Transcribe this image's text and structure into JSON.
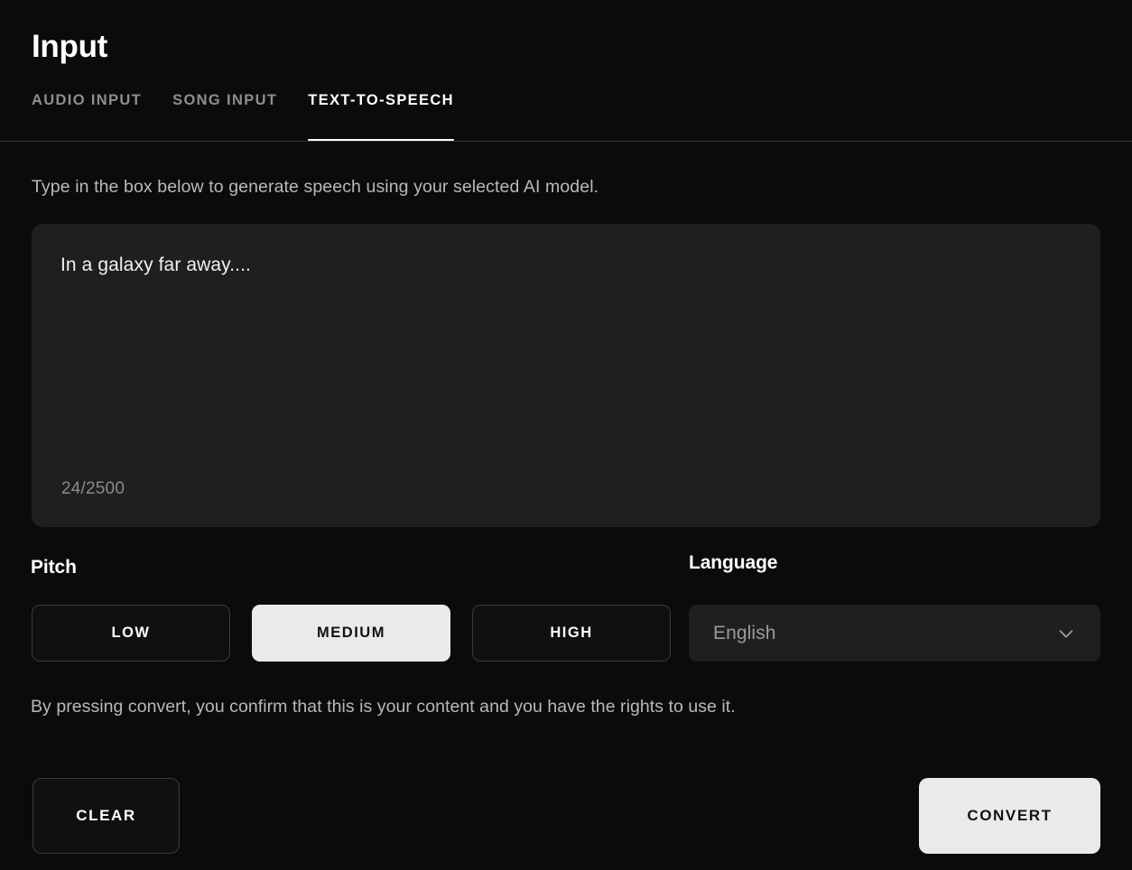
{
  "header": {
    "title": "Input"
  },
  "tabs": [
    {
      "label": "AUDIO INPUT",
      "active": false
    },
    {
      "label": "SONG INPUT",
      "active": false
    },
    {
      "label": "TEXT-TO-SPEECH",
      "active": true
    }
  ],
  "main": {
    "helper_text": "Type in the box below to generate speech using your selected AI model.",
    "textarea": {
      "value": "In a galaxy far away....",
      "placeholder": "",
      "char_count": "24/2500",
      "max_length": 2500,
      "current_length": 24
    },
    "pitch": {
      "label": "Pitch",
      "options": [
        {
          "label": "LOW",
          "selected": false
        },
        {
          "label": "MEDIUM",
          "selected": true
        },
        {
          "label": "HIGH",
          "selected": false
        }
      ],
      "selected": "MEDIUM"
    },
    "language": {
      "label": "Language",
      "value": "English",
      "icon": "chevron-down-icon"
    },
    "disclaimer": "By pressing convert, you confirm that this is your content and you have the rights to use it."
  },
  "footer": {
    "clear_label": "CLEAR",
    "convert_label": "CONVERT"
  },
  "colors": {
    "page_background": "#0b0b0b",
    "surface": "#1f1f1f",
    "accent_light": "#eaeaea",
    "text_primary": "#ffffff",
    "text_secondary": "#b9b9b9",
    "text_muted": "#8a8a8a",
    "border": "#3b3b3b",
    "divider": "#333333"
  }
}
